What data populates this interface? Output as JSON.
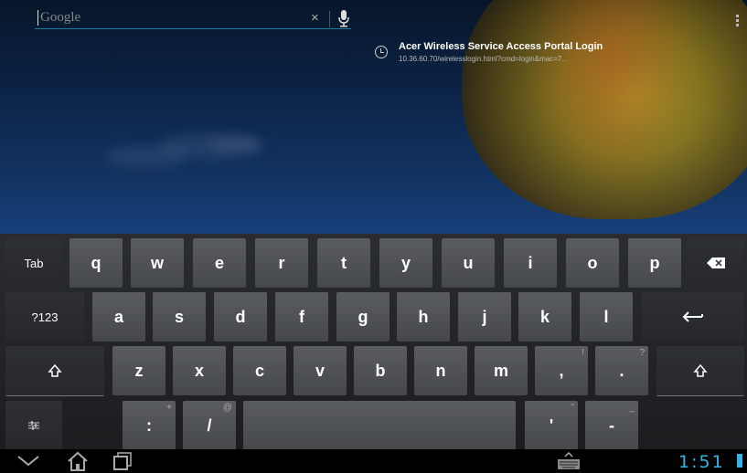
{
  "search": {
    "placeholder": "Google",
    "clear_symbol": "×"
  },
  "suggestion": {
    "title": "Acer Wireless Service Access Portal Login",
    "url": "10.36.60.70/wirelesslogin.html?cmd=login&mac=7..."
  },
  "keyboard": {
    "row1": {
      "tab": "Tab",
      "keys": [
        "q",
        "w",
        "e",
        "r",
        "t",
        "y",
        "u",
        "i",
        "o",
        "p"
      ]
    },
    "row2": {
      "symbols": "?123",
      "keys": [
        "a",
        "s",
        "d",
        "f",
        "g",
        "h",
        "j",
        "k",
        "l"
      ]
    },
    "row3": {
      "keys": [
        "z",
        "x",
        "c",
        "v",
        "b",
        "n",
        "m",
        ",",
        "."
      ],
      "hints": {
        ",": "!",
        ".": "?"
      }
    },
    "row4": {
      "colon": ":",
      "colon_hint": "+",
      "slash": "/",
      "slash_hint": "@",
      "apostrophe": "'",
      "apostrophe_hint": "\"",
      "dash": "-",
      "dash_hint": "_"
    }
  },
  "status": {
    "time": "1:51"
  },
  "icons": [
    "search-icon",
    "clear-icon",
    "mic-icon",
    "menu-icon",
    "history-icon",
    "backspace-icon",
    "enter-icon",
    "shift-icon",
    "settings-icon",
    "back-icon",
    "home-icon",
    "recent-apps-icon",
    "keyboard-icon",
    "battery-icon"
  ],
  "colors": {
    "accent": "#33b5e5",
    "key": "#505356",
    "keyboard_bg": "#222426"
  }
}
